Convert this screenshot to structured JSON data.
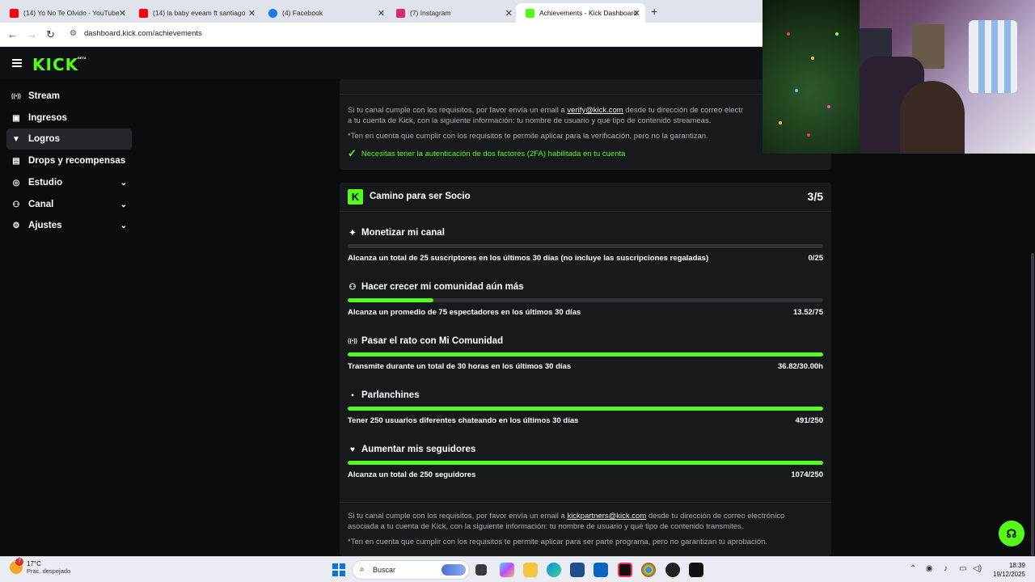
{
  "browser": {
    "tabs": [
      {
        "title": "(14) Yo No Te Olvido - YouTube",
        "color": "#ff0000"
      },
      {
        "title": "(14) la baby eveam ft santiago",
        "color": "#ff0000"
      },
      {
        "title": "(4) Facebook",
        "color": "#1877f2"
      },
      {
        "title": "(7) Instagram",
        "color": "#d62976"
      },
      {
        "title": "Achievements - Kick Dashboard",
        "color": "#53fc18"
      }
    ],
    "url": "dashboard.kick.com/achievements"
  },
  "kick": {
    "logo": "KICK",
    "beta": "BETA",
    "accent": "#53fc18",
    "sidebar": [
      {
        "label": "Stream",
        "icon": "broadcast-icon",
        "glyph": "((•))",
        "chevron": false,
        "active": false
      },
      {
        "label": "Ingresos",
        "icon": "revenue-icon",
        "glyph": "▣",
        "chevron": false,
        "active": false
      },
      {
        "label": "Logros",
        "icon": "trophy-icon",
        "glyph": "🏆",
        "chevron": false,
        "active": true
      },
      {
        "label": "Drops y recompensas",
        "icon": "drops-icon",
        "glyph": "▤",
        "chevron": false,
        "active": false
      },
      {
        "label": "Estudio",
        "icon": "studio-icon",
        "glyph": "◎",
        "chevron": true,
        "active": false
      },
      {
        "label": "Canal",
        "icon": "channel-icon",
        "glyph": "⚇",
        "chevron": true,
        "active": false
      },
      {
        "label": "Ajustes",
        "icon": "gear-icon",
        "glyph": "⚙",
        "chevron": true,
        "active": false
      }
    ],
    "verify": {
      "line1_pre": "Si tu canal cumple con los requisitos, por favor envía un email a ",
      "email": "verify@kick.com",
      "line1_post": " desde tu dirección de correo electr",
      "line2": "a tu cuenta de Kick, con la siguiente información: tu nombre de usuario y qué tipo de contenido streameas.",
      "note": "*Ten en cuenta que cumplir con los requisitos te permite aplicar para la verificación, pero no la garantizan.",
      "check": "Necesitas tener la autenticación de dos factores (2FA) habilitada en tu cuenta"
    },
    "partner": {
      "badge": "K",
      "title": "Camino para ser Socio",
      "score": "3/5",
      "tasks": [
        {
          "title": "Monetizar mi canal",
          "icon": "sparkle-icon",
          "glyph": "✦",
          "desc": "Alcanza un total de 25 suscriptores en los últimos 30 días (no incluye las suscripciones regaladas)",
          "value": "0/25",
          "progress": 0
        },
        {
          "title": "Hacer crecer mi comunidad aún más",
          "icon": "community-icon",
          "glyph": "⚇",
          "desc": "Alcanza un promedio de 75 espectadores en los últimos 30 días",
          "value": "13.52/75",
          "progress": 0.18
        },
        {
          "title": "Pasar el rato con Mi Comunidad",
          "icon": "broadcast-icon",
          "glyph": "((•))",
          "desc": "Transmite durante un total de 30 horas en los últimos 30 días",
          "value": "36.82/30.00h",
          "progress": 1
        },
        {
          "title": "Parlanchines",
          "icon": "chat-icon",
          "glyph": "💬",
          "desc": "Tener 250 usuarios diferentes chateando en los últimos 30 días",
          "value": "491/250",
          "progress": 1
        },
        {
          "title": "Aumentar mis seguidores",
          "icon": "heart-icon",
          "glyph": "♥",
          "desc": "Alcanza un total de 250 seguidores",
          "value": "1074/250",
          "progress": 1
        }
      ],
      "apply_pre": "Si tu canal cumple con los requisitos, por favor envía un email a ",
      "apply_email": "kickpartners@kick.com",
      "apply_post": " desde tu dirección de correo electrónico",
      "apply_line2": "asociada a tu cuenta de Kick, con la siguiente información: tu nombre de usuario y qué tipo de contenido transmites.",
      "apply_note": "*Ten en cuenta que cumplir con los requisitos te permite aplicar para ser parte programa, pero no garantizan tu aprobación."
    }
  },
  "taskbar": {
    "weather_badge": "7",
    "temp": "17°C",
    "condition": "Prac. despejado",
    "search": "Buscar",
    "time": "18:39",
    "date": "19/12/2025"
  }
}
